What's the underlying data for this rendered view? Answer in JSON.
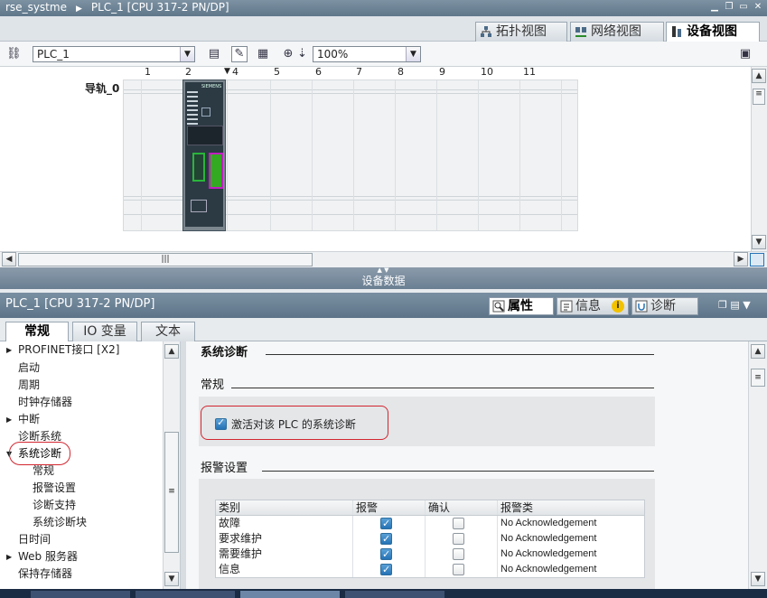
{
  "titlebar": {
    "project": "rse_systme",
    "device": "PLC_1 [CPU 317-2 PN/DP]"
  },
  "view_tabs": [
    {
      "label": "拓扑视图",
      "icon": "topology-view-icon"
    },
    {
      "label": "网络视图",
      "icon": "network-view-icon"
    },
    {
      "label": "设备视图",
      "icon": "device-view-icon"
    }
  ],
  "active_view_tab": "设备视图",
  "toolbar": {
    "device_select": "PLC_1",
    "zoom": "100%"
  },
  "canvas": {
    "rail_label": "导轨_0",
    "slots": [
      "1",
      "2",
      "4",
      "5",
      "6",
      "7",
      "8",
      "9",
      "10",
      "11"
    ],
    "module_brand": "SIEMENS"
  },
  "device_data_label": "设备数据",
  "inspector": {
    "title": "PLC_1 [CPU 317-2 PN/DP]",
    "tabs": [
      {
        "label": "属性",
        "icon": "properties-icon"
      },
      {
        "label": "信息",
        "icon": "info-icon"
      },
      {
        "label": "诊断",
        "icon": "diagnostics-icon"
      }
    ],
    "active_tab": "属性",
    "subtabs": [
      "常规",
      "IO 变量",
      "文本"
    ],
    "active_subtab": "常规"
  },
  "nav_tree": [
    {
      "label": "PROFINET接口 [X2]",
      "indent": 0,
      "arrow": "right"
    },
    {
      "label": "启动",
      "indent": 0
    },
    {
      "label": "周期",
      "indent": 0
    },
    {
      "label": "时钟存储器",
      "indent": 0
    },
    {
      "label": "中断",
      "indent": 0,
      "arrow": "right"
    },
    {
      "label": "诊断系统",
      "indent": 0
    },
    {
      "label": "系统诊断",
      "indent": 0,
      "arrow": "down",
      "selected": true
    },
    {
      "label": "常规",
      "indent": 2
    },
    {
      "label": "报警设置",
      "indent": 1
    },
    {
      "label": "诊断支持",
      "indent": 1
    },
    {
      "label": "系统诊断块",
      "indent": 1
    },
    {
      "label": "日时间",
      "indent": 0
    },
    {
      "label": "Web 服务器",
      "indent": 0,
      "arrow": "right"
    },
    {
      "label": "保持存储器",
      "indent": 0
    }
  ],
  "content": {
    "section_title": "系统诊断",
    "general_title": "常规",
    "activate_label": "激活对该 PLC 的系统诊断",
    "activate_checked": true,
    "alarm_title": "报警设置",
    "table_headers": [
      "类别",
      "报警",
      "确认",
      "报警类"
    ],
    "rows": [
      {
        "category": "故障",
        "alarm": true,
        "ack": false,
        "alarm_class": "No Acknowledgement"
      },
      {
        "category": "要求维护",
        "alarm": true,
        "ack": false,
        "alarm_class": "No Acknowledgement"
      },
      {
        "category": "需要维护",
        "alarm": true,
        "ack": false,
        "alarm_class": "No Acknowledgement"
      },
      {
        "category": "信息",
        "alarm": true,
        "ack": false,
        "alarm_class": "No Acknowledgement"
      }
    ]
  },
  "colors": {
    "accent": "#2573b6",
    "callout": "#d2262f",
    "titlebar": "#6b8194"
  }
}
